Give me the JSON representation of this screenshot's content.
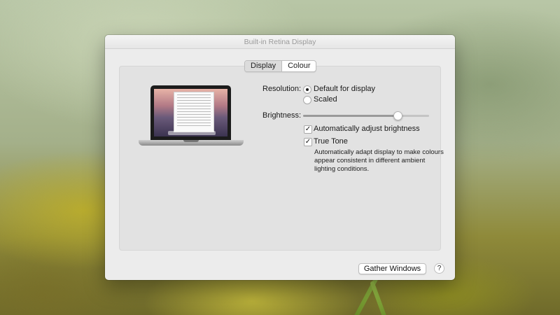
{
  "window": {
    "title": "Built-in Retina Display"
  },
  "tabs": [
    {
      "label": "Display",
      "active": true
    },
    {
      "label": "Colour",
      "active": false
    }
  ],
  "resolution": {
    "label": "Resolution:",
    "options": [
      {
        "label": "Default for display",
        "selected": true
      },
      {
        "label": "Scaled",
        "selected": false
      }
    ]
  },
  "brightness": {
    "label": "Brightness:",
    "level": 0.75,
    "auto_adjust": {
      "label": "Automatically adjust brightness",
      "checked": true
    }
  },
  "true_tone": {
    "label": "True Tone",
    "checked": true,
    "description": "Automatically adapt display to make colours appear consistent in different ambient lighting conditions."
  },
  "footer": {
    "gather_label": "Gather Windows",
    "help_label": "?"
  },
  "icons": {
    "checkmark": "✓"
  }
}
